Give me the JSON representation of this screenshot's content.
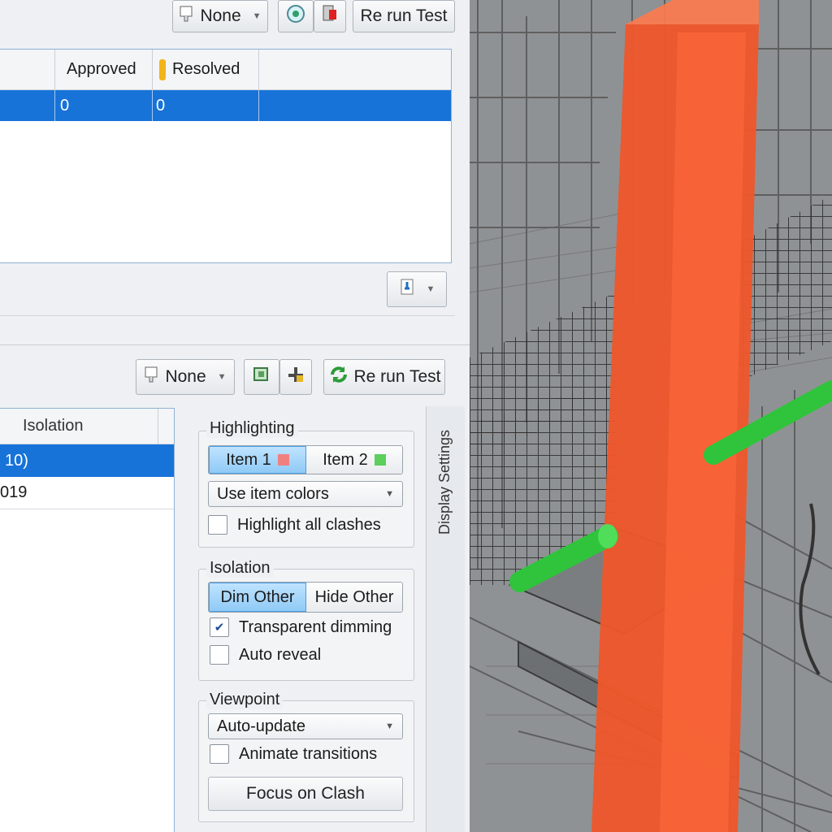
{
  "top_toolbar": {
    "filter_value": "None",
    "rerun_label": "Re run Test"
  },
  "results_table": {
    "columns": [
      "Approved",
      "Resolved"
    ],
    "rows": [
      [
        "0",
        "0"
      ]
    ]
  },
  "bottom_toolbar": {
    "filter_value": "None",
    "rerun_label": "Re run Test"
  },
  "clash_list": {
    "header": "Isolation",
    "rows": [
      "10)",
      "019"
    ]
  },
  "side_tab_label": "Display Settings",
  "highlighting": {
    "title": "Highlighting",
    "item1_label": "Item 1",
    "item2_label": "Item 2",
    "item1_color": "#f08080",
    "item2_color": "#5ccf5c",
    "color_mode": "Use item colors",
    "highlight_all_label": "Highlight all clashes",
    "highlight_all_checked": false
  },
  "isolation": {
    "title": "Isolation",
    "dim_label": "Dim Other",
    "hide_label": "Hide Other",
    "transparent_label": "Transparent dimming",
    "transparent_checked": true,
    "auto_reveal_label": "Auto reveal",
    "auto_reveal_checked": false
  },
  "viewpoint": {
    "title": "Viewpoint",
    "mode": "Auto-update",
    "animate_label": "Animate transitions",
    "animate_checked": false,
    "focus_label": "Focus on Clash"
  },
  "colors": {
    "selection": "#1773d8",
    "clash_column": "#f0562a",
    "pipe": "#2fc43c"
  }
}
